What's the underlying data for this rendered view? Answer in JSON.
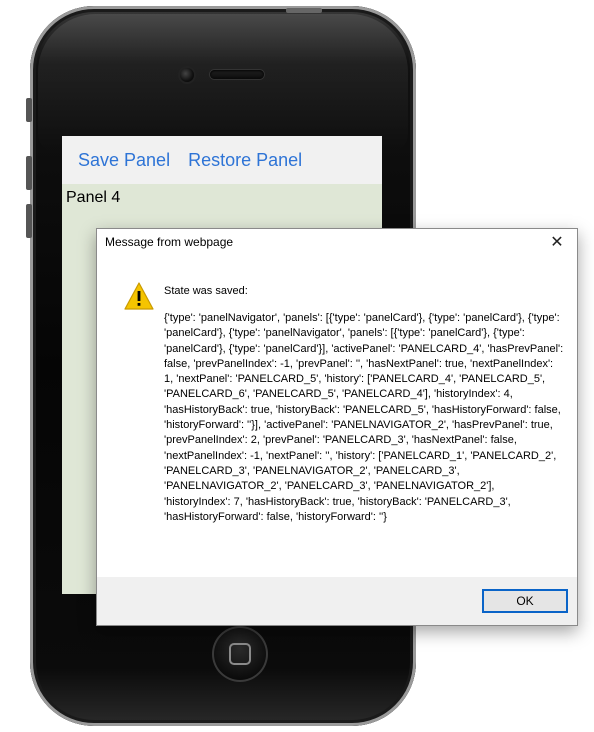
{
  "toolbar": {
    "save_label": "Save Panel",
    "restore_label": "Restore Panel"
  },
  "panel": {
    "label": "Panel 4"
  },
  "dialog": {
    "title": "Message from webpage",
    "close_glyph": "✕",
    "heading": "State was saved:",
    "message": "{'type': 'panelNavigator', 'panels': [{'type': 'panelCard'}, {'type': 'panelCard'}, {'type': 'panelCard'}, {'type': 'panelNavigator', 'panels': [{'type': 'panelCard'}, {'type': 'panelCard'}, {'type': 'panelCard'}], 'activePanel': 'PANELCARD_4', 'hasPrevPanel': false, 'prevPanelIndex': -1, 'prevPanel': '', 'hasNextPanel': true, 'nextPanelIndex': 1, 'nextPanel': 'PANELCARD_5', 'history': ['PANELCARD_4', 'PANELCARD_5', 'PANELCARD_6', 'PANELCARD_5', 'PANELCARD_4'], 'historyIndex': 4, 'hasHistoryBack': true, 'historyBack': 'PANELCARD_5', 'hasHistoryForward': false, 'historyForward': ''}], 'activePanel': 'PANELNAVIGATOR_2', 'hasPrevPanel': true, 'prevPanelIndex': 2, 'prevPanel': 'PANELCARD_3', 'hasNextPanel': false, 'nextPanelIndex': -1, 'nextPanel': '', 'history': ['PANELCARD_1', 'PANELCARD_2', 'PANELCARD_3', 'PANELNAVIGATOR_2', 'PANELCARD_3', 'PANELNAVIGATOR_2', 'PANELCARD_3', 'PANELNAVIGATOR_2'], 'historyIndex': 7, 'hasHistoryBack': true, 'historyBack': 'PANELCARD_3', 'hasHistoryForward': false, 'historyForward': ''}",
    "ok_label": "OK",
    "icon": "warning-icon"
  },
  "colors": {
    "link_blue": "#2e74d6",
    "screen_bg": "#dfe7d6",
    "warning_yellow": "#f5c400"
  }
}
